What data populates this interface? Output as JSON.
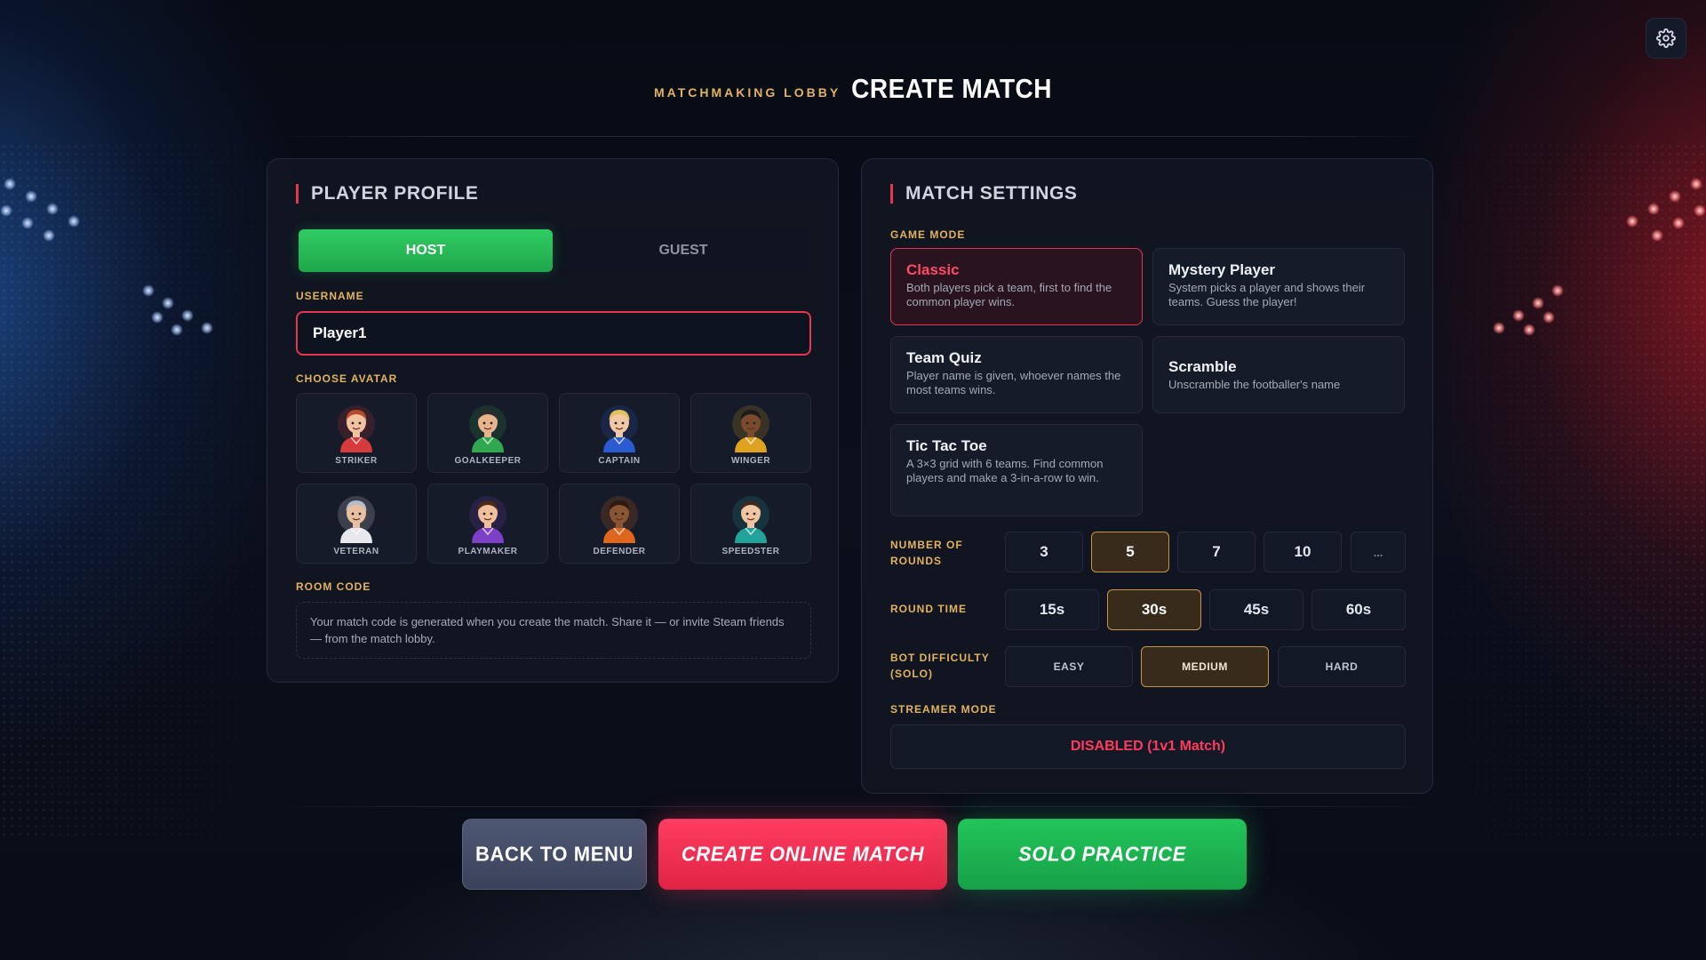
{
  "header": {
    "subtitle": "MATCHMAKING LOBBY",
    "title": "CREATE MATCH"
  },
  "player_profile": {
    "title": "PLAYER PROFILE",
    "role_toggle": {
      "options": [
        "HOST",
        "GUEST"
      ],
      "selected": "HOST"
    },
    "username_label": "USERNAME",
    "username_value": "Player1",
    "avatar_label": "CHOOSE AVATAR",
    "avatars": [
      {
        "name": "STRIKER",
        "shirt": "#d63a3a",
        "skin": "#f0c2a0",
        "hair": "#b84a2a"
      },
      {
        "name": "GOALKEEPER",
        "shirt": "#2fa84f",
        "skin": "#e7b48e",
        "hair": "#2b2b2b"
      },
      {
        "name": "CAPTAIN",
        "shirt": "#2a5bd1",
        "skin": "#f2c7a4",
        "hair": "#e2c15a"
      },
      {
        "name": "WINGER",
        "shirt": "#e0a21e",
        "skin": "#7a4a2c",
        "hair": "#1c1c1c"
      },
      {
        "name": "VETERAN",
        "shirt": "#e8e8ec",
        "skin": "#e8bfa0",
        "hair": "#b8bcc6"
      },
      {
        "name": "PLAYMAKER",
        "shirt": "#7d3fc8",
        "skin": "#f0c09c",
        "hair": "#4a2a1c"
      },
      {
        "name": "DEFENDER",
        "shirt": "#e0661e",
        "skin": "#8a5532",
        "hair": "#2a1a12"
      },
      {
        "name": "SPEEDSTER",
        "shirt": "#22a39a",
        "skin": "#f1c5a2",
        "hair": "#3a2a20"
      }
    ],
    "room_code_label": "ROOM CODE",
    "room_code_text": "Your match code is generated when you create the match. Share it — or invite Steam friends — from the match lobby."
  },
  "match_settings": {
    "title": "MATCH SETTINGS",
    "game_mode_label": "GAME MODE",
    "modes": [
      {
        "title": "Classic",
        "desc": "Both players pick a team, first to find the common player wins."
      },
      {
        "title": "Mystery Player",
        "desc": "System picks a player and shows their teams. Guess the player!"
      },
      {
        "title": "Team Quiz",
        "desc": "Player name is given, whoever names the most teams wins."
      },
      {
        "title": "Scramble",
        "desc": "Unscramble the footballer's name"
      },
      {
        "title": "Tic Tac Toe",
        "desc": "A 3×3 grid with 6 teams. Find common players and make a 3-in-a-row to win."
      }
    ],
    "selected_mode": "Classic",
    "rounds_label": "NUMBER OF ROUNDS",
    "rounds_options": [
      "3",
      "5",
      "7",
      "10",
      "..."
    ],
    "rounds_selected": "5",
    "round_time_label": "ROUND TIME",
    "round_time_options": [
      "15s",
      "30s",
      "45s",
      "60s"
    ],
    "round_time_selected": "30s",
    "bot_difficulty_label": "BOT DIFFICULTY (SOLO)",
    "bot_difficulty_options": [
      "EASY",
      "MEDIUM",
      "HARD"
    ],
    "bot_difficulty_selected": "MEDIUM",
    "streamer_mode_label": "STREAMER MODE",
    "streamer_mode_value": "DISABLED (1v1 Match)"
  },
  "actions": {
    "back": "BACK TO MENU",
    "create": "CREATE ONLINE MATCH",
    "solo": "SOLO PRACTICE"
  },
  "colors": {
    "accent_red": "#e8344e",
    "accent_green": "#2fcc62",
    "accent_gold": "#e3b25c"
  }
}
